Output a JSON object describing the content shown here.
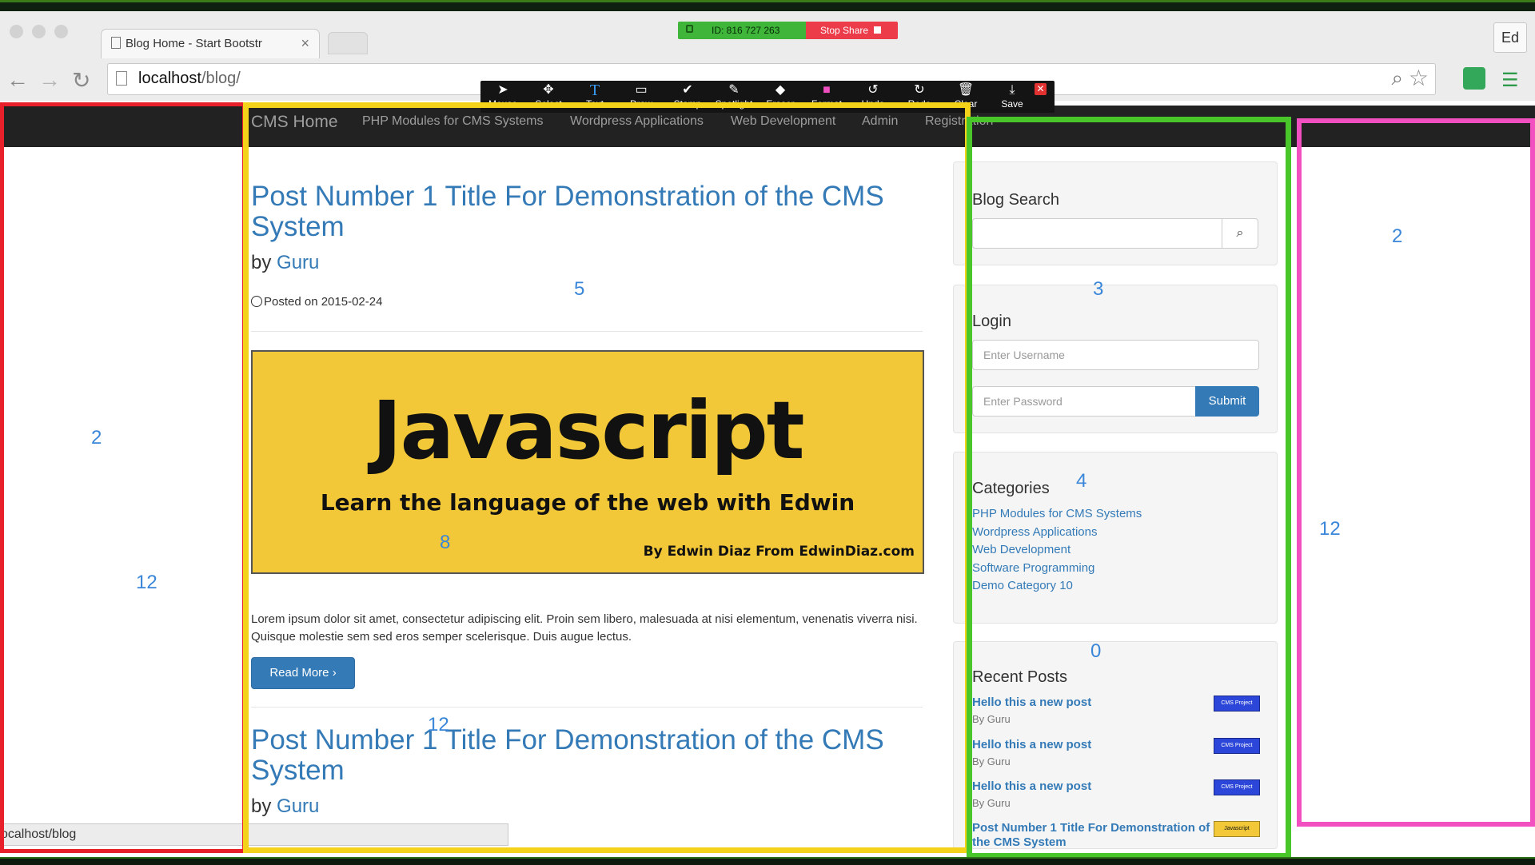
{
  "share_bar": {
    "meeting_id": "ID: 816 727 263",
    "stop_label": "Stop Share"
  },
  "browser": {
    "tab_title": "Blog Home - Start Bootstr",
    "address_host": "localhost",
    "address_path": "/blog/",
    "profile": "Ed",
    "status_url": "ocalhost/blog"
  },
  "annot_toolbar": {
    "tools": [
      "Mouse",
      "Select",
      "Text",
      "Draw",
      "Stamp",
      "Spotlight",
      "Eraser",
      "Format",
      "Undo",
      "Redo",
      "Clear",
      "Save"
    ]
  },
  "site_nav": {
    "brand": "CMS Home",
    "links": [
      "PHP Modules for CMS Systems",
      "Wordpress Applications",
      "Web Development",
      "Admin",
      "Registration"
    ]
  },
  "posts": [
    {
      "title": "Post Number 1 Title For Demonstration of the CMS System",
      "by_prefix": "by",
      "author": "Guru",
      "posted": "Posted on 2015-02-24",
      "banner": {
        "headline": "Javascript",
        "sub": "Learn the language of the web with Edwin",
        "credit": "By Edwin Diaz From EdwinDiaz.com"
      },
      "excerpt": "Lorem ipsum dolor sit amet, consectetur adipiscing elit. Proin sem libero, malesuada at nisi elementum, venenatis viverra nisi. Quisque molestie sem sed eros semper scelerisque. Duis augue lectus.",
      "read_more": "Read More"
    },
    {
      "title": "Post Number 1 Title For Demonstration of the CMS System",
      "by_prefix": "by",
      "author": "Guru"
    }
  ],
  "sidebar": {
    "search": {
      "heading": "Blog Search",
      "placeholder": ""
    },
    "login": {
      "heading": "Login",
      "username_placeholder": "Enter Username",
      "password_placeholder": "Enter Password",
      "submit": "Submit"
    },
    "categories": {
      "heading": "Categories",
      "items": [
        "PHP Modules for CMS Systems",
        "Wordpress Applications",
        "Web Development",
        "Software Programming",
        "Demo Category 10"
      ]
    },
    "recent": {
      "heading": "Recent Posts",
      "items": [
        {
          "title": "Hello this a new post",
          "by": "By Guru",
          "thumb": "CMS Project"
        },
        {
          "title": "Hello this a new post",
          "by": "By Guru",
          "thumb": "CMS Project"
        },
        {
          "title": "Hello this a new post",
          "by": "By Guru",
          "thumb": "CMS Project"
        },
        {
          "title": "Post Number 1 Title For Demonstration of the CMS System",
          "by": "",
          "thumb": "Javascript"
        }
      ]
    }
  },
  "overlay": {
    "colors": {
      "red": "#e8202a",
      "yellow": "#f5d21a",
      "green": "#49c72a",
      "magenta": "#f24fc0",
      "label": "#3a86d9"
    },
    "labels": {
      "left_top": "2",
      "left_bottom": "12",
      "main_top": "5",
      "main_mid": "8",
      "main_bottom": "12",
      "side_a": "3",
      "side_b": "4",
      "side_c": "0",
      "right_top": "2",
      "right_mid": "12"
    }
  }
}
